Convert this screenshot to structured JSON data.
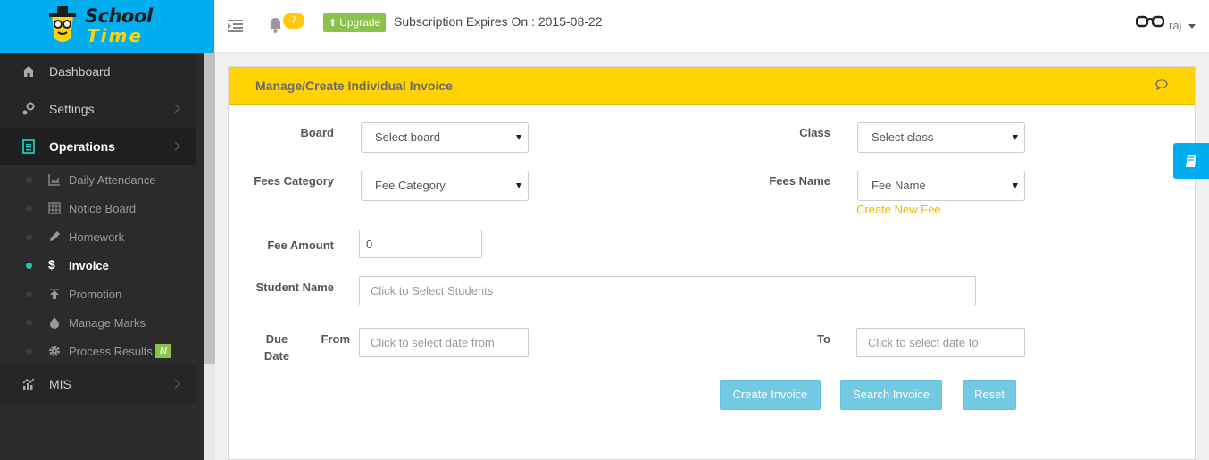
{
  "brand": {
    "line1": "School",
    "line2": "Time"
  },
  "topbar": {
    "notification_count": "7",
    "upgrade_label": "Upgrade",
    "subscription_text": "Subscription Expires On : 2015-08-22",
    "user_name": "raj"
  },
  "sidebar": {
    "items": [
      {
        "label": "Dashboard",
        "icon": "home-icon"
      },
      {
        "label": "Settings",
        "icon": "settings-icon"
      },
      {
        "label": "Operations",
        "icon": "list-icon",
        "expanded": true
      },
      {
        "label": "MIS",
        "icon": "chart-icon"
      }
    ],
    "sub_items": [
      {
        "label": "Daily Attendance",
        "icon": "area-chart-icon"
      },
      {
        "label": "Notice Board",
        "icon": "table-icon"
      },
      {
        "label": "Homework",
        "icon": "pencil-icon"
      },
      {
        "label": "Invoice",
        "icon": "dollar-icon",
        "active": true
      },
      {
        "label": "Promotion",
        "icon": "upload-arrow-icon"
      },
      {
        "label": "Manage Marks",
        "icon": "drop-icon"
      },
      {
        "label": "Process Results",
        "icon": "gear-icon",
        "badge": "N"
      }
    ]
  },
  "panel": {
    "title": "Manage/Create Individual Invoice",
    "form": {
      "board_label": "Board",
      "board_value": "Select board",
      "class_label": "Class",
      "class_value": "Select class",
      "fees_category_label": "Fees Category",
      "fees_category_value": "Fee Category",
      "fees_name_label": "Fees Name",
      "fees_name_value": "Fee Name",
      "create_new_fee": "Create New Fee",
      "fee_amount_label": "Fee Amount",
      "fee_amount_value": "0",
      "student_name_label": "Student Name",
      "student_name_placeholder": "Click to Select Students",
      "due_label_line1": "Due",
      "due_label_line2": "Date",
      "from_label": "From",
      "from_placeholder": "Click to select date from",
      "to_label": "To",
      "to_placeholder": "Click to select date to"
    },
    "buttons": {
      "create": "Create Invoice",
      "search": "Search Invoice",
      "reset": "Reset"
    }
  },
  "colors": {
    "brand_blue": "#00aeef",
    "header_yellow": "#ffd200",
    "accent_teal": "#1fc6b3",
    "button_info": "#5bc0de",
    "badge_green": "#8bc34a"
  }
}
